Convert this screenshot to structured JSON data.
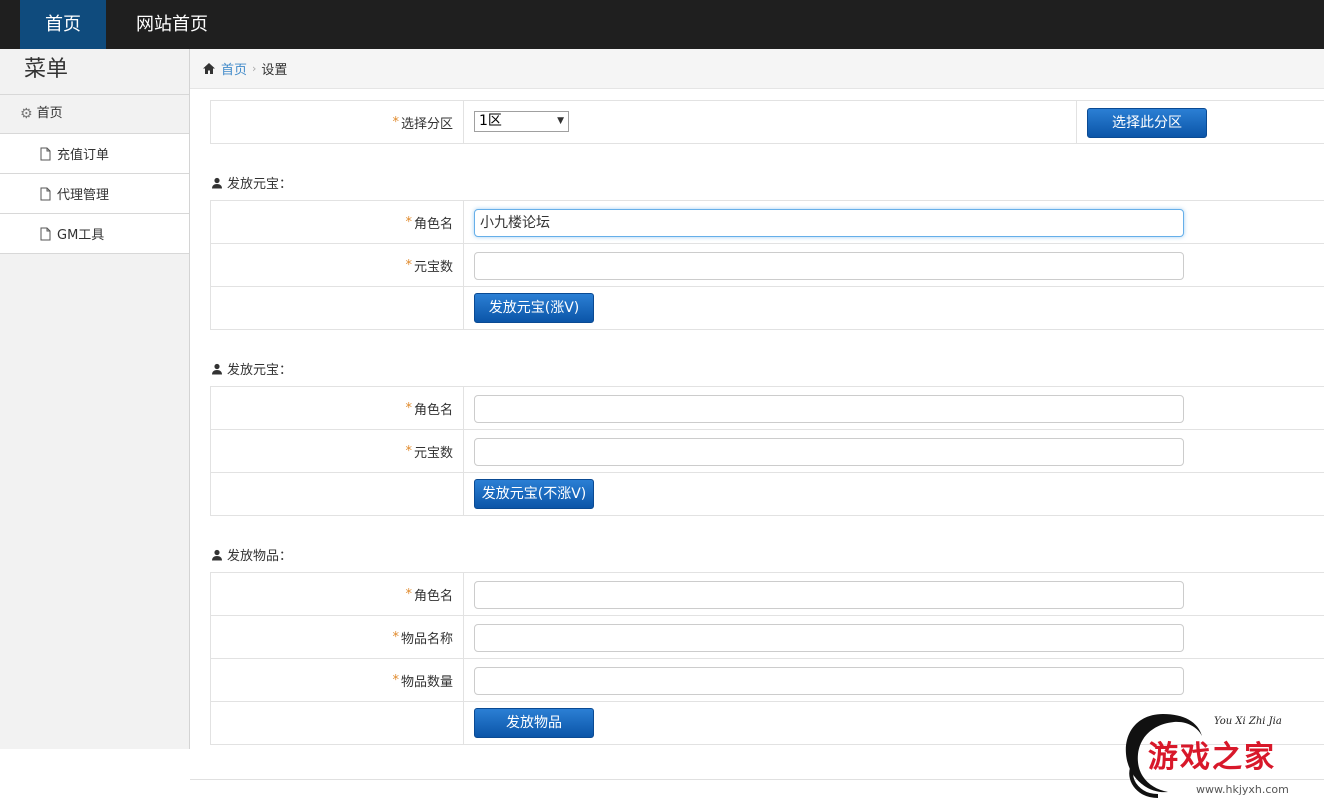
{
  "topbar": {
    "nav_home": "首页",
    "nav_site": "网站首页"
  },
  "sidebar": {
    "title": "菜单",
    "home": "首页",
    "items": [
      {
        "label": "充值订单"
      },
      {
        "label": "代理管理"
      },
      {
        "label": "GM工具"
      }
    ]
  },
  "breadcrumb": {
    "home": "首页",
    "current": "设置"
  },
  "zone": {
    "label": "选择分区",
    "selected": "1区",
    "button": "选择此分区"
  },
  "sections": [
    {
      "title": "发放元宝：",
      "fields": [
        {
          "label": "角色名",
          "value": "小九楼论坛"
        },
        {
          "label": "元宝数",
          "value": ""
        }
      ],
      "button": "发放元宝(涨V)"
    },
    {
      "title": "发放元宝：",
      "fields": [
        {
          "label": "角色名",
          "value": ""
        },
        {
          "label": "元宝数",
          "value": ""
        }
      ],
      "button": "发放元宝(不涨V)"
    },
    {
      "title": "发放物品：",
      "fields": [
        {
          "label": "角色名",
          "value": ""
        },
        {
          "label": "物品名称",
          "value": ""
        },
        {
          "label": "物品数量",
          "value": ""
        }
      ],
      "button": "发放物品"
    }
  ],
  "required_mark": "*",
  "watermark": {
    "script": "You Xi Zhi Jia",
    "name": "游戏之家",
    "url": "www.hkjyxh.com"
  },
  "colors": {
    "topbar": "#1f1f1f",
    "active_nav": "#0f4b7d",
    "button": "#1565c0",
    "required": "#e08a2c",
    "link": "#428bca"
  }
}
